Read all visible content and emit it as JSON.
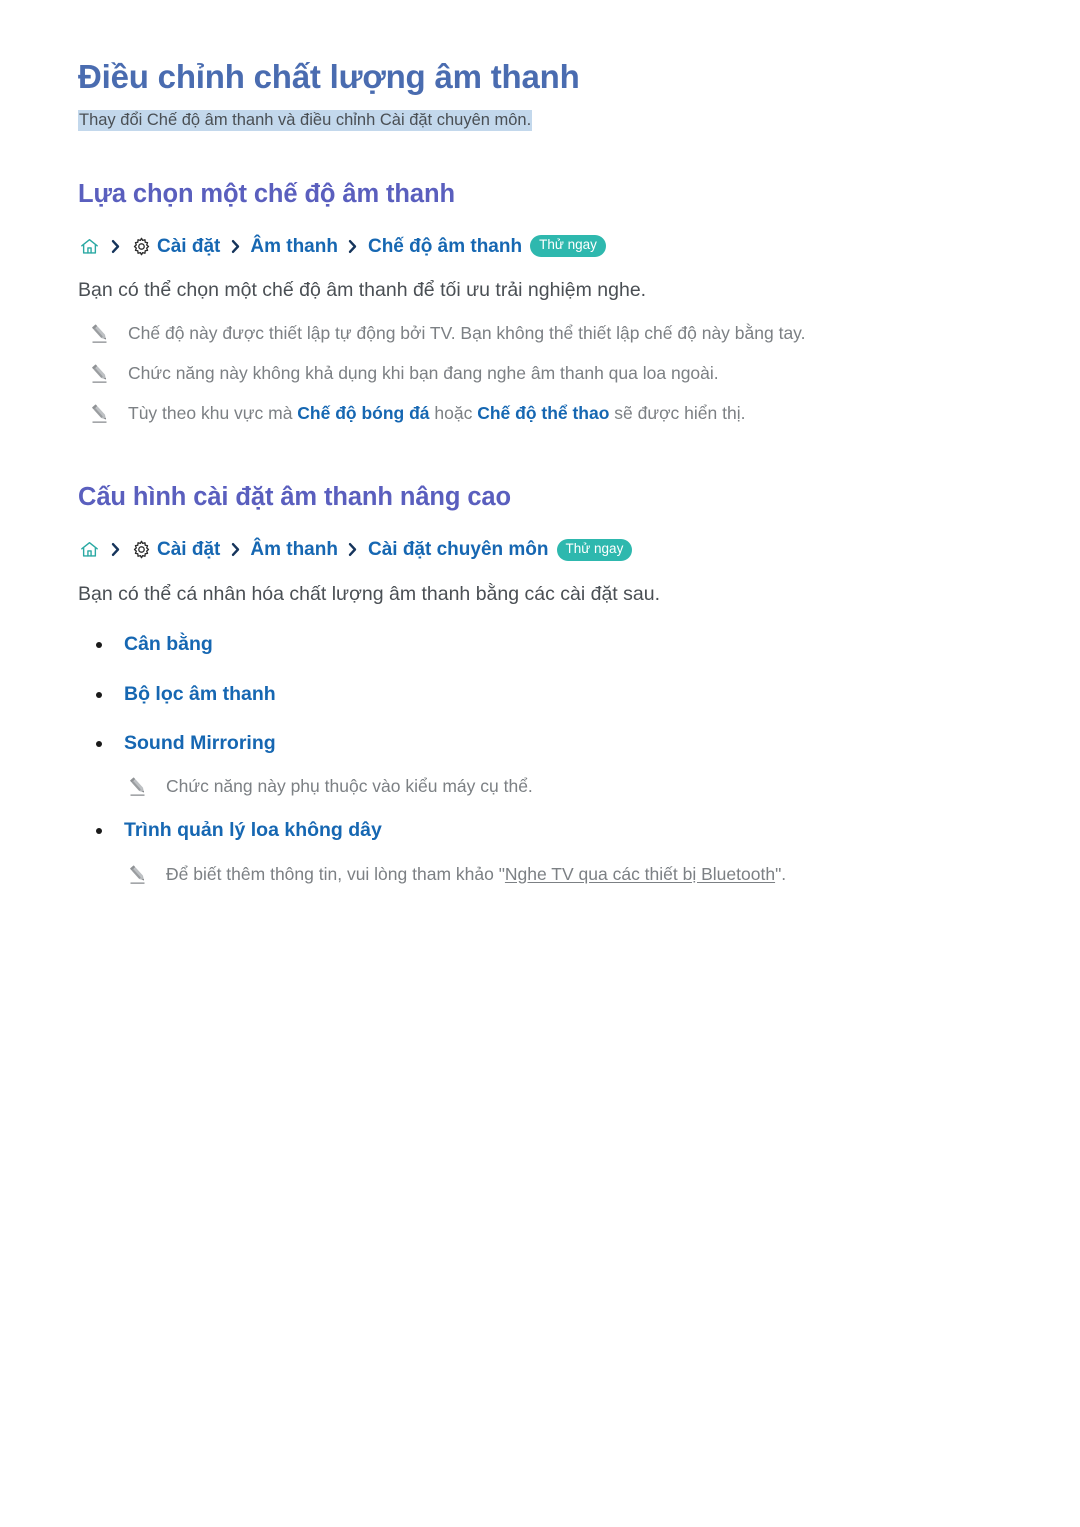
{
  "document": {
    "title": "Điều chỉnh chất lượng âm thanh",
    "subtitle": "Thay đổi Chế độ âm thanh và điều chỉnh Cài đặt chuyên môn.",
    "try_now_label": "Thử ngay"
  },
  "colors": {
    "title": "#4a6cb0",
    "heading": "#5a5fbe",
    "link_blue": "#1667b2",
    "badge_teal": "#2eb8ae",
    "highlight": "#c3d8ec",
    "body_gray": "#4a4f54",
    "note_gray": "#7c8084"
  },
  "sections": [
    {
      "heading": "Lựa chọn một chế độ âm thanh",
      "breadcrumb": {
        "home_icon": "home-icon",
        "gear_icon": "gear-icon",
        "separator_icon": "chevron-right-icon",
        "crumbs": [
          "Cài đặt",
          "Âm thanh",
          "Chế độ âm thanh"
        ],
        "badge": "Thử ngay"
      },
      "body": "Bạn có thể chọn một chế độ âm thanh để tối ưu trải nghiệm nghe.",
      "notes": [
        {
          "icon": "pencil-icon",
          "parts": [
            {
              "text": "Chế độ này được thiết lập tự động bởi TV. Bạn không thể thiết lập chế độ này bằng tay.",
              "style": "plain"
            }
          ]
        },
        {
          "icon": "pencil-icon",
          "parts": [
            {
              "text": "Chức năng này không khả dụng khi bạn đang nghe âm thanh qua loa ngoài.",
              "style": "plain"
            }
          ]
        },
        {
          "icon": "pencil-icon",
          "parts": [
            {
              "text": "Tùy theo khu vực mà ",
              "style": "plain"
            },
            {
              "text": "Chế độ bóng đá",
              "style": "emph"
            },
            {
              "text": " hoặc ",
              "style": "plain"
            },
            {
              "text": "Chế độ thể thao",
              "style": "emph"
            },
            {
              "text": " sẽ được hiển thị.",
              "style": "plain"
            }
          ]
        }
      ],
      "bullets": []
    },
    {
      "heading": "Cấu hình cài đặt âm thanh nâng cao",
      "breadcrumb": {
        "home_icon": "home-icon",
        "gear_icon": "gear-icon",
        "separator_icon": "chevron-right-icon",
        "crumbs": [
          "Cài đặt",
          "Âm thanh",
          "Cài đặt chuyên môn"
        ],
        "badge": "Thử ngay"
      },
      "body": "Bạn có thể cá nhân hóa chất lượng âm thanh bằng các cài đặt sau.",
      "notes": [],
      "bullets": [
        {
          "label": "Cân bằng",
          "note": null
        },
        {
          "label": "Bộ lọc âm thanh",
          "note": null
        },
        {
          "label": "Sound Mirroring",
          "note": {
            "icon": "pencil-icon",
            "parts": [
              {
                "text": "Chức năng này phụ thuộc vào kiểu máy cụ thể.",
                "style": "plain"
              }
            ]
          }
        },
        {
          "label": "Trình quản lý loa không dây",
          "note": {
            "icon": "pencil-icon",
            "parts": [
              {
                "text": "Để biết thêm thông tin, vui lòng tham khảo \"",
                "style": "plain"
              },
              {
                "text": "Nghe TV qua các thiết bị Bluetooth",
                "style": "link"
              },
              {
                "text": "\".",
                "style": "plain"
              }
            ]
          }
        }
      ]
    }
  ]
}
